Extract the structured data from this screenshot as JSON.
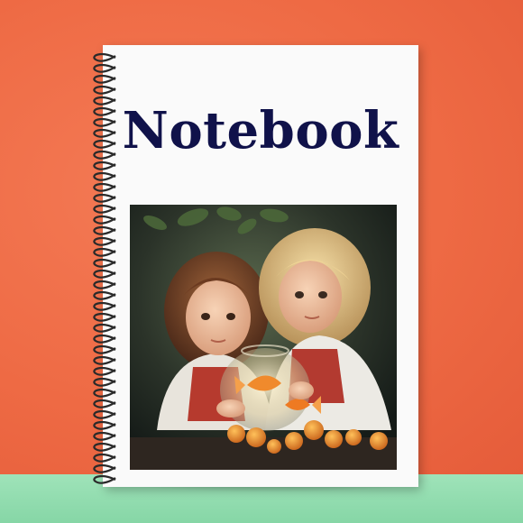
{
  "notebook": {
    "title": "Notebook"
  },
  "colors": {
    "wall": "#ee6a44",
    "shelf": "#9fe3b9",
    "cover": "#fafafa",
    "title": "#10124a",
    "spiral": "#2a2a2a"
  },
  "cover_art": {
    "subject": "two-children-with-goldfish-bowl"
  }
}
